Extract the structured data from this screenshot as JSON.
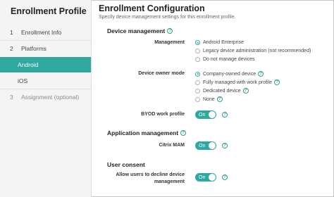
{
  "sidebar": {
    "title": "Enrollment Profile",
    "items": [
      {
        "number": "1",
        "label": "Enrollment Info"
      },
      {
        "number": "2",
        "label": "Platforms"
      },
      {
        "number": "",
        "label": "Android"
      },
      {
        "number": "",
        "label": "iOS"
      },
      {
        "number": "3",
        "label": "Assignment (optional)"
      }
    ]
  },
  "main": {
    "title": "Enrollment Configuration",
    "subtitle": "Specify device management settings for this enrollment profile.",
    "device_management": {
      "title": "Device management",
      "management": {
        "label": "Management",
        "options": [
          "Android Enterprise",
          "Legacy device administration (not recommended)",
          "Do not manage devices"
        ],
        "selected": "Android Enterprise"
      },
      "owner_mode": {
        "label": "Device owner mode",
        "options": [
          "Company-owned device",
          "Fully managed with work profile",
          "Dedicated device",
          "None"
        ],
        "selected": "Company-owned device"
      },
      "byod": {
        "label": "BYOD work profile",
        "state": "On"
      }
    },
    "application_management": {
      "title": "Application management",
      "citrix_mam": {
        "label": "Citrix MAM",
        "state": "On"
      }
    },
    "user_consent": {
      "title": "User consent",
      "decline": {
        "label_line1": "Allow users to decline device",
        "label_line2": "management",
        "state": "On"
      }
    }
  },
  "colors": {
    "accent": "#2fa8a0",
    "help": "#2e9d8f"
  },
  "icons": {
    "help": "help-icon",
    "radio": "radio-button"
  }
}
